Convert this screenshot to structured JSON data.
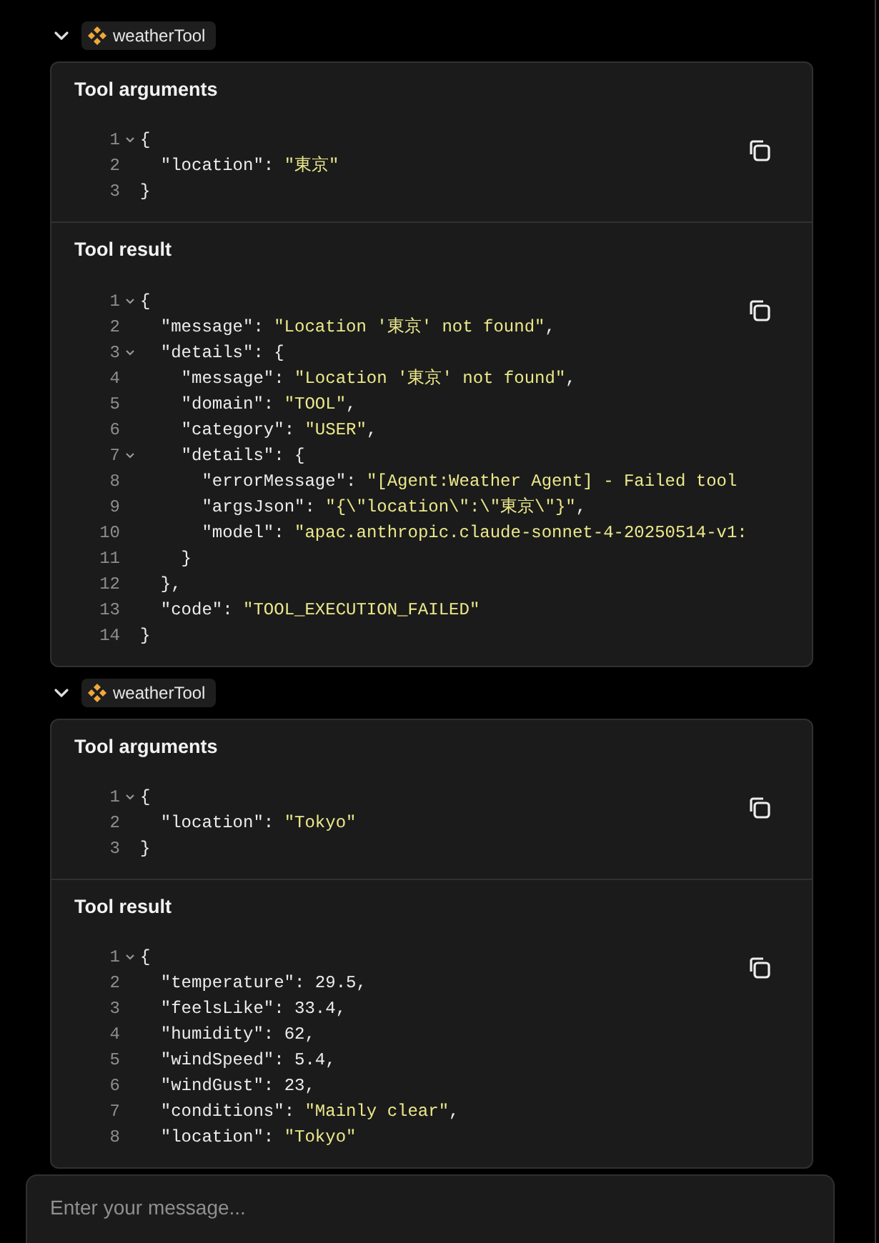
{
  "tool_calls": [
    {
      "expanded": true,
      "name": "weatherTool",
      "sections": [
        {
          "title": "Tool arguments",
          "lines": [
            {
              "number": "1",
              "foldable": true,
              "parts": [
                {
                  "kind": "punct",
                  "text": "{"
                }
              ]
            },
            {
              "number": "2",
              "foldable": false,
              "parts": [
                {
                  "kind": "key",
                  "text": "\"location\""
                },
                {
                  "kind": "punct",
                  "text": ": "
                },
                {
                  "kind": "string",
                  "text": "\"東京\""
                }
              ]
            },
            {
              "number": "3",
              "foldable": false,
              "parts": [
                {
                  "kind": "punct",
                  "text": "}"
                }
              ]
            }
          ]
        },
        {
          "title": "Tool result",
          "lines": [
            {
              "number": "1",
              "foldable": true,
              "parts": [
                {
                  "kind": "punct",
                  "text": "{"
                }
              ]
            },
            {
              "number": "2",
              "foldable": false,
              "parts": [
                {
                  "kind": "key",
                  "text": "\"message\""
                },
                {
                  "kind": "punct",
                  "text": ": "
                },
                {
                  "kind": "string",
                  "text": "\"Location '東京' not found\""
                },
                {
                  "kind": "punct",
                  "text": ","
                }
              ]
            },
            {
              "number": "3",
              "foldable": true,
              "parts": [
                {
                  "kind": "key",
                  "text": "\"details\""
                },
                {
                  "kind": "punct",
                  "text": ": {"
                }
              ]
            },
            {
              "number": "4",
              "foldable": false,
              "parts": [
                {
                  "kind": "key",
                  "text": "\"message\""
                },
                {
                  "kind": "punct",
                  "text": ": "
                },
                {
                  "kind": "string",
                  "text": "\"Location '東京' not found\""
                },
                {
                  "kind": "punct",
                  "text": ","
                }
              ]
            },
            {
              "number": "5",
              "foldable": false,
              "parts": [
                {
                  "kind": "key",
                  "text": "\"domain\""
                },
                {
                  "kind": "punct",
                  "text": ": "
                },
                {
                  "kind": "string",
                  "text": "\"TOOL\""
                },
                {
                  "kind": "punct",
                  "text": ","
                }
              ]
            },
            {
              "number": "6",
              "foldable": false,
              "parts": [
                {
                  "kind": "key",
                  "text": "\"category\""
                },
                {
                  "kind": "punct",
                  "text": ": "
                },
                {
                  "kind": "string",
                  "text": "\"USER\""
                },
                {
                  "kind": "punct",
                  "text": ","
                }
              ]
            },
            {
              "number": "7",
              "foldable": true,
              "parts": [
                {
                  "kind": "key",
                  "text": "\"details\""
                },
                {
                  "kind": "punct",
                  "text": ": {"
                }
              ]
            },
            {
              "number": "8",
              "foldable": false,
              "parts": [
                {
                  "kind": "key",
                  "text": "\"errorMessage\""
                },
                {
                  "kind": "punct",
                  "text": ": "
                },
                {
                  "kind": "string",
                  "text": "\"[Agent:Weather Agent] - Failed tool"
                }
              ]
            },
            {
              "number": "9",
              "foldable": false,
              "parts": [
                {
                  "kind": "key",
                  "text": "\"argsJson\""
                },
                {
                  "kind": "punct",
                  "text": ": "
                },
                {
                  "kind": "string",
                  "text": "\"{\\\"location\\\":\\\"東京\\\"}\""
                },
                {
                  "kind": "punct",
                  "text": ","
                }
              ]
            },
            {
              "number": "10",
              "foldable": false,
              "parts": [
                {
                  "kind": "key",
                  "text": "\"model\""
                },
                {
                  "kind": "punct",
                  "text": ": "
                },
                {
                  "kind": "string",
                  "text": "\"apac.anthropic.claude-sonnet-4-20250514-v1:"
                }
              ]
            },
            {
              "number": "11",
              "foldable": false,
              "parts": [
                {
                  "kind": "punct",
                  "text": "}"
                }
              ]
            },
            {
              "number": "12",
              "foldable": false,
              "parts": [
                {
                  "kind": "punct",
                  "text": "},"
                }
              ]
            },
            {
              "number": "13",
              "foldable": false,
              "parts": [
                {
                  "kind": "key",
                  "text": "\"code\""
                },
                {
                  "kind": "punct",
                  "text": ": "
                },
                {
                  "kind": "string",
                  "text": "\"TOOL_EXECUTION_FAILED\""
                }
              ]
            },
            {
              "number": "14",
              "foldable": false,
              "parts": [
                {
                  "kind": "punct",
                  "text": "}"
                }
              ]
            }
          ]
        }
      ]
    },
    {
      "expanded": true,
      "name": "weatherTool",
      "sections": [
        {
          "title": "Tool arguments",
          "lines": [
            {
              "number": "1",
              "foldable": true,
              "parts": [
                {
                  "kind": "punct",
                  "text": "{"
                }
              ]
            },
            {
              "number": "2",
              "foldable": false,
              "parts": [
                {
                  "kind": "key",
                  "text": "\"location\""
                },
                {
                  "kind": "punct",
                  "text": ": "
                },
                {
                  "kind": "string",
                  "text": "\"Tokyo\""
                }
              ]
            },
            {
              "number": "3",
              "foldable": false,
              "parts": [
                {
                  "kind": "punct",
                  "text": "}"
                }
              ]
            }
          ]
        },
        {
          "title": "Tool result",
          "lines": [
            {
              "number": "1",
              "foldable": true,
              "parts": [
                {
                  "kind": "punct",
                  "text": "{"
                }
              ]
            },
            {
              "number": "2",
              "foldable": false,
              "parts": [
                {
                  "kind": "key",
                  "text": "\"temperature\""
                },
                {
                  "kind": "punct",
                  "text": ": "
                },
                {
                  "kind": "number",
                  "text": "29.5"
                },
                {
                  "kind": "punct",
                  "text": ","
                }
              ]
            },
            {
              "number": "3",
              "foldable": false,
              "parts": [
                {
                  "kind": "key",
                  "text": "\"feelsLike\""
                },
                {
                  "kind": "punct",
                  "text": ": "
                },
                {
                  "kind": "number",
                  "text": "33.4"
                },
                {
                  "kind": "punct",
                  "text": ","
                }
              ]
            },
            {
              "number": "4",
              "foldable": false,
              "parts": [
                {
                  "kind": "key",
                  "text": "\"humidity\""
                },
                {
                  "kind": "punct",
                  "text": ": "
                },
                {
                  "kind": "number",
                  "text": "62"
                },
                {
                  "kind": "punct",
                  "text": ","
                }
              ]
            },
            {
              "number": "5",
              "foldable": false,
              "parts": [
                {
                  "kind": "key",
                  "text": "\"windSpeed\""
                },
                {
                  "kind": "punct",
                  "text": ": "
                },
                {
                  "kind": "number",
                  "text": "5.4"
                },
                {
                  "kind": "punct",
                  "text": ","
                }
              ]
            },
            {
              "number": "6",
              "foldable": false,
              "parts": [
                {
                  "kind": "key",
                  "text": "\"windGust\""
                },
                {
                  "kind": "punct",
                  "text": ": "
                },
                {
                  "kind": "number",
                  "text": "23"
                },
                {
                  "kind": "punct",
                  "text": ","
                }
              ]
            },
            {
              "number": "7",
              "foldable": false,
              "parts": [
                {
                  "kind": "key",
                  "text": "\"conditions\""
                },
                {
                  "kind": "punct",
                  "text": ": "
                },
                {
                  "kind": "string",
                  "text": "\"Mainly clear\""
                },
                {
                  "kind": "punct",
                  "text": ","
                }
              ]
            },
            {
              "number": "8",
              "foldable": false,
              "parts": [
                {
                  "kind": "key",
                  "text": "\"location\""
                },
                {
                  "kind": "punct",
                  "text": ": "
                },
                {
                  "kind": "string",
                  "text": "\"Tokyo\""
                }
              ]
            }
          ]
        }
      ]
    }
  ],
  "composer": {
    "placeholder": "Enter your message..."
  }
}
